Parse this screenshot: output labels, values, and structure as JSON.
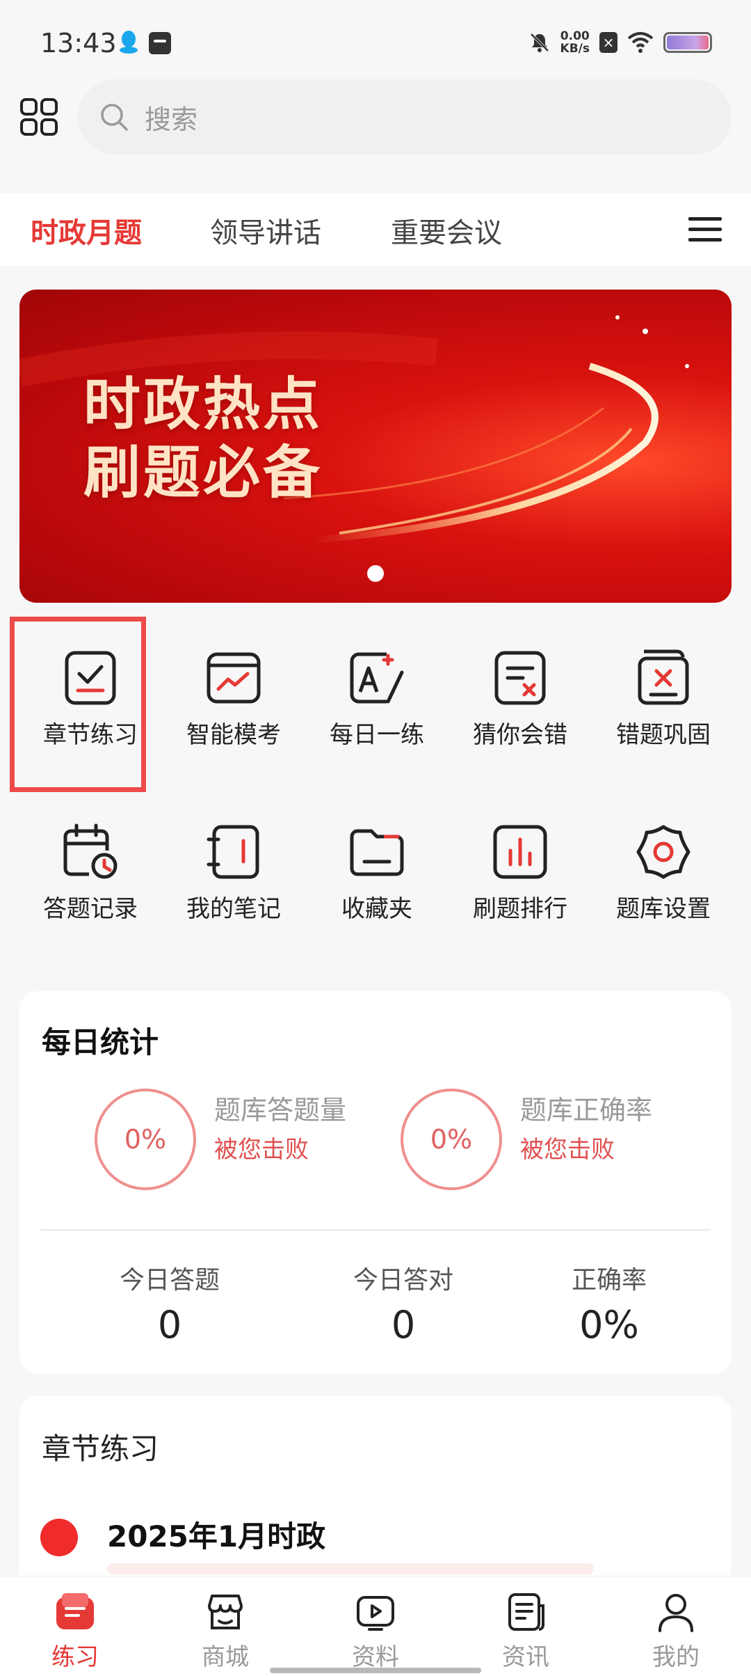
{
  "status_bar": {
    "time": "13:43",
    "net_speed_value": "0.00",
    "net_speed_unit": "KB/s"
  },
  "search": {
    "placeholder": "搜索"
  },
  "tabs": [
    {
      "label": "时政月题",
      "active": true
    },
    {
      "label": "领导讲话",
      "active": false
    },
    {
      "label": "重要会议",
      "active": false
    }
  ],
  "banner": {
    "line1": "时政热点",
    "line2": "刷题必备"
  },
  "features": [
    {
      "label": "章节练习",
      "icon": "checklist-icon"
    },
    {
      "label": "智能模考",
      "icon": "trend-chart-icon"
    },
    {
      "label": "每日一练",
      "icon": "grade-edit-icon"
    },
    {
      "label": "猜你会错",
      "icon": "doc-x-icon"
    },
    {
      "label": "错题巩固",
      "icon": "folder-x-icon"
    },
    {
      "label": "答题记录",
      "icon": "calendar-clock-icon"
    },
    {
      "label": "我的笔记",
      "icon": "notebook-icon"
    },
    {
      "label": "收藏夹",
      "icon": "folder-icon"
    },
    {
      "label": "刷题排行",
      "icon": "bar-chart-icon"
    },
    {
      "label": "题库设置",
      "icon": "settings-flower-icon"
    }
  ],
  "daily_stats": {
    "title": "每日统计",
    "left_ring": {
      "percent": "0%",
      "label": "题库答题量",
      "beat": "被您击败"
    },
    "right_ring": {
      "percent": "0%",
      "label": "题库正确率",
      "beat": "被您击败"
    },
    "today": [
      {
        "label": "今日答题",
        "value": "0"
      },
      {
        "label": "今日答对",
        "value": "0"
      },
      {
        "label": "正确率",
        "value": "0%"
      }
    ]
  },
  "chapter": {
    "title": "章节练习",
    "item_name": "2025年1月时政"
  },
  "bottom_nav": [
    {
      "label": "练习",
      "active": true
    },
    {
      "label": "商城",
      "active": false
    },
    {
      "label": "资料",
      "active": false
    },
    {
      "label": "资讯",
      "active": false
    },
    {
      "label": "我的",
      "active": false
    }
  ],
  "colors": {
    "accent": "#e53935",
    "highlight_border": "#ef4a4a"
  }
}
